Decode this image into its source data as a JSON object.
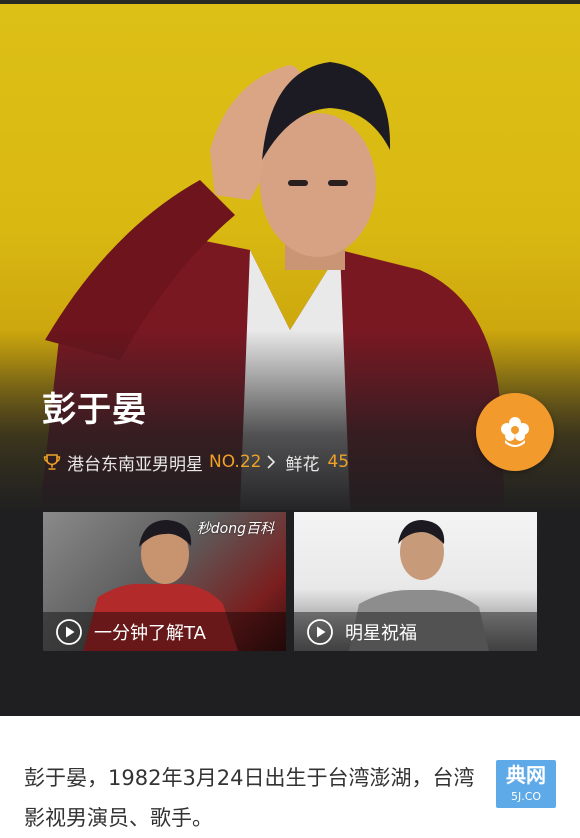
{
  "profile": {
    "name": "彭于晏",
    "ranking_category": "港台东南亚男明星",
    "ranking_no": "NO.22",
    "flowers_label": "鲜花",
    "flowers_count": "45"
  },
  "videos": [
    {
      "label": "一分钟了解TA",
      "watermark": "秒dong百科"
    },
    {
      "label": "明星祝福"
    }
  ],
  "bio": {
    "text": "彭于晏，1982年3月24日出生于台湾澎湖，台湾影视男演员、歌手。"
  },
  "site_badge": {
    "line1": "典网",
    "line2": "5J.CO"
  },
  "icons": {
    "trophy": "trophy-icon",
    "chevron": "chevron-right-icon",
    "flower": "flower-icon",
    "play": "play-circle-icon"
  },
  "colors": {
    "accent": "#f0a126",
    "flower_button": "#f29a2c",
    "hero_background": "#1f1f21",
    "hero_yellow": "#dcc016"
  }
}
